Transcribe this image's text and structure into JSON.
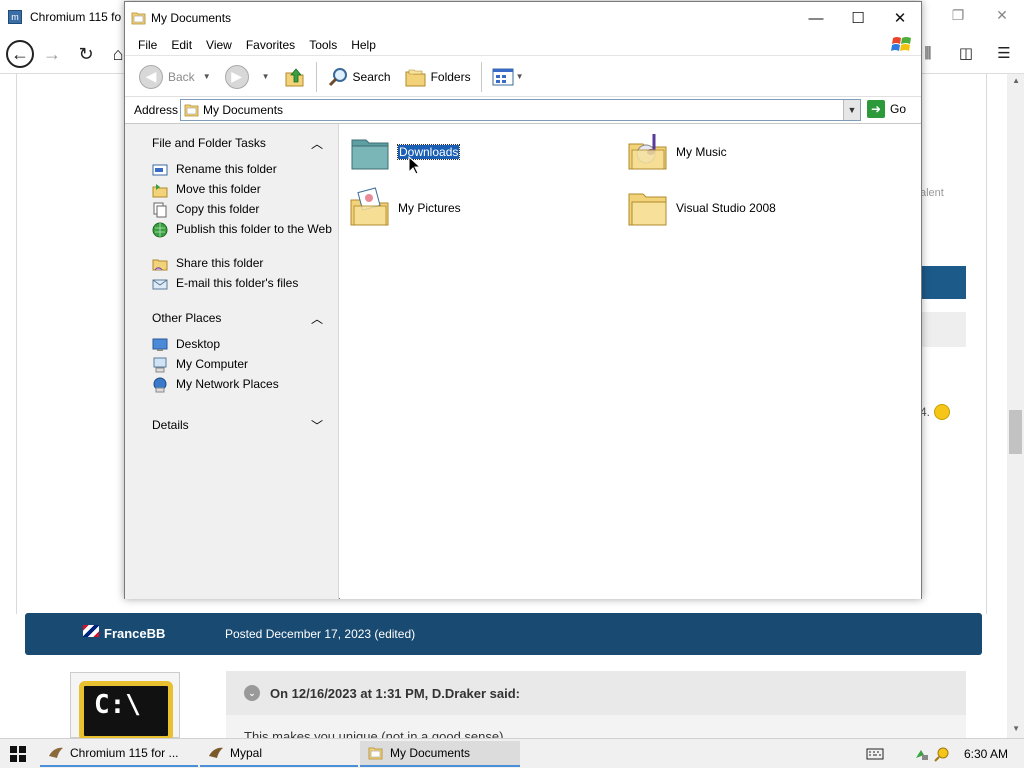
{
  "browser": {
    "tab_title": "Chromium 115 fo",
    "right_faded_text": "alent",
    "emoji_text": "4.",
    "post": {
      "author": "FranceBB",
      "date": "Posted December 17, 2023 (edited)",
      "quote_header": "On 12/16/2023 at 1:31 PM, D.Draker said:",
      "quote_body": "This makes you unique (not in a good sense)",
      "avatar_text": "C:\\"
    }
  },
  "explorer": {
    "title": "My Documents",
    "menu": [
      "File",
      "Edit",
      "View",
      "Favorites",
      "Tools",
      "Help"
    ],
    "toolbar": {
      "back": "Back",
      "search": "Search",
      "folders": "Folders"
    },
    "address": {
      "label": "Address",
      "value": "My Documents",
      "go": "Go"
    },
    "tasks": {
      "file_folder_tasks": {
        "title": "File and Folder Tasks",
        "items": [
          "Rename this folder",
          "Move this folder",
          "Copy this folder",
          "Publish this folder to the Web",
          "Share this folder",
          "E-mail this folder's files"
        ]
      },
      "other_places": {
        "title": "Other Places",
        "items": [
          "Desktop",
          "My Computer",
          "My Network Places"
        ]
      },
      "details": {
        "title": "Details"
      }
    },
    "files": [
      {
        "name": "Downloads",
        "selected": true
      },
      {
        "name": "My Music",
        "selected": false
      },
      {
        "name": "My Pictures",
        "selected": false
      },
      {
        "name": "Visual Studio 2008",
        "selected": false
      }
    ]
  },
  "taskbar": {
    "tasks": [
      "Chromium 115 for ...",
      "Mypal",
      "My Documents"
    ],
    "clock": "6:30 AM"
  },
  "colors": {
    "selection": "#1a5fb4",
    "forum_blue": "#184a72",
    "task_pane": "#f0f0f0"
  }
}
